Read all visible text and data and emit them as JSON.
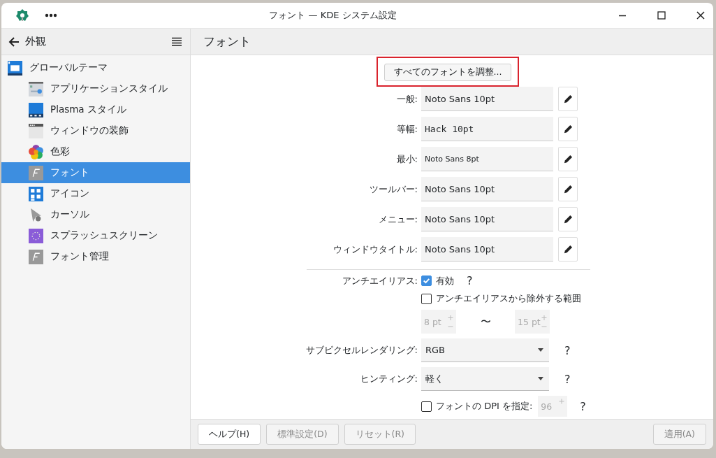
{
  "window": {
    "title": "フォント — KDE システム設定"
  },
  "sidebar": {
    "back_label": "外観",
    "items": [
      {
        "label": "グローバルテーマ",
        "selected": false,
        "children": [
          {
            "label": "アプリケーションスタイル",
            "selected": false
          },
          {
            "label": "Plasma スタイル",
            "selected": false
          },
          {
            "label": "ウィンドウの装飾",
            "selected": false
          },
          {
            "label": "色彩",
            "selected": false
          },
          {
            "label": "フォント",
            "selected": true
          },
          {
            "label": "アイコン",
            "selected": false
          },
          {
            "label": "カーソル",
            "selected": false
          },
          {
            "label": "スプラッシュスクリーン",
            "selected": false
          },
          {
            "label": "フォント管理",
            "selected": false
          }
        ]
      }
    ]
  },
  "page": {
    "title": "フォント",
    "adjust_all_button": {
      "label": "すべてのフォントを調整...",
      "highlighted": true
    },
    "fonts": [
      {
        "label": "一般:",
        "value": "Noto Sans 10pt",
        "kind": "normal"
      },
      {
        "label": "等幅:",
        "value": "Hack 10pt",
        "kind": "mono"
      },
      {
        "label": "最小:",
        "value": "Noto Sans 8pt",
        "kind": "small"
      },
      {
        "label": "ツールバー:",
        "value": "Noto Sans 10pt",
        "kind": "normal"
      },
      {
        "label": "メニュー:",
        "value": "Noto Sans 10pt",
        "kind": "normal"
      },
      {
        "label": "ウィンドウタイトル:",
        "value": "Noto Sans 10pt",
        "kind": "normal"
      }
    ],
    "antialiasing": {
      "label": "アンチエイリアス:",
      "enabled_label": "有効",
      "checked": true,
      "help": "?",
      "exclude_label": "アンチエイリアスから除外する範囲",
      "exclude_checked": false,
      "range_from": "8 pt",
      "range_sep": "〜",
      "range_to": "15 pt"
    },
    "subpixel": {
      "label": "サブピクセルレンダリング:",
      "value": "RGB",
      "help": "?"
    },
    "hinting": {
      "label": "ヒンティング:",
      "value": "軽く",
      "help": "?"
    },
    "dpi": {
      "label": "フォントの DPI を指定:",
      "checked": false,
      "value": "96",
      "help": "?"
    }
  },
  "footer": {
    "buttons": [
      {
        "label": "ヘルプ(H)",
        "disabled": false
      },
      {
        "label": "標準設定(D)",
        "disabled": true
      },
      {
        "label": "リセット(R)",
        "disabled": true
      }
    ],
    "apply": {
      "label": "適用(A)",
      "disabled": true
    }
  }
}
